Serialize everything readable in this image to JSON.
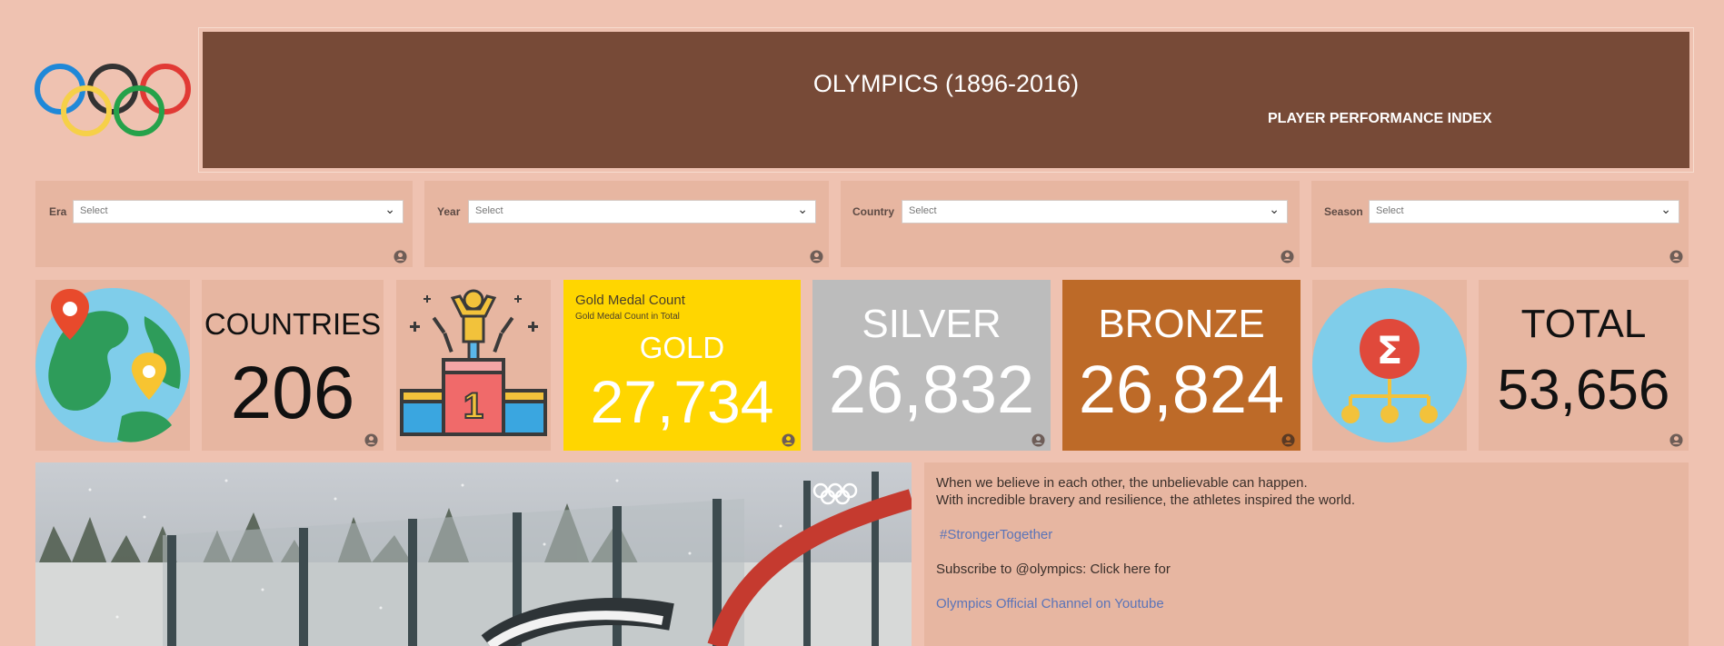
{
  "header": {
    "title": "OLYMPICS (1896-2016)",
    "subtitle": "PLAYER PERFORMANCE INDEX"
  },
  "filters": [
    {
      "label": "Era",
      "value": "Select"
    },
    {
      "label": "Year",
      "value": "Select"
    },
    {
      "label": "Country",
      "value": "Select"
    },
    {
      "label": "Season",
      "value": "Select"
    }
  ],
  "kpis": {
    "countries": {
      "label": "COUNTRIES",
      "value": "206"
    },
    "gold": {
      "header": "Gold Medal Count",
      "subheader": "Gold Medal Count in Total",
      "label": "GOLD",
      "value": "27,734",
      "color": "#ffd600"
    },
    "silver": {
      "label": "SILVER",
      "value": "26,832",
      "color": "#bcbcbc"
    },
    "bronze": {
      "label": "BRONZE",
      "value": "26,824",
      "color": "#bd6a28"
    },
    "total": {
      "label": "TOTAL",
      "value": "53,656"
    }
  },
  "info": {
    "line1": "When we believe in each other, the unbelievable can happen.",
    "line2": "With incredible bravery and resilience, the athletes inspired the world.",
    "hashtag": "#StrongerTogether",
    "subscribe": "Subscribe to @olympics: Click here for",
    "channel_link": "Olympics Official Channel on Youtube"
  },
  "colors": {
    "background": "#efc2b1",
    "panel": "#e7b6a1",
    "banner": "#774a37"
  }
}
